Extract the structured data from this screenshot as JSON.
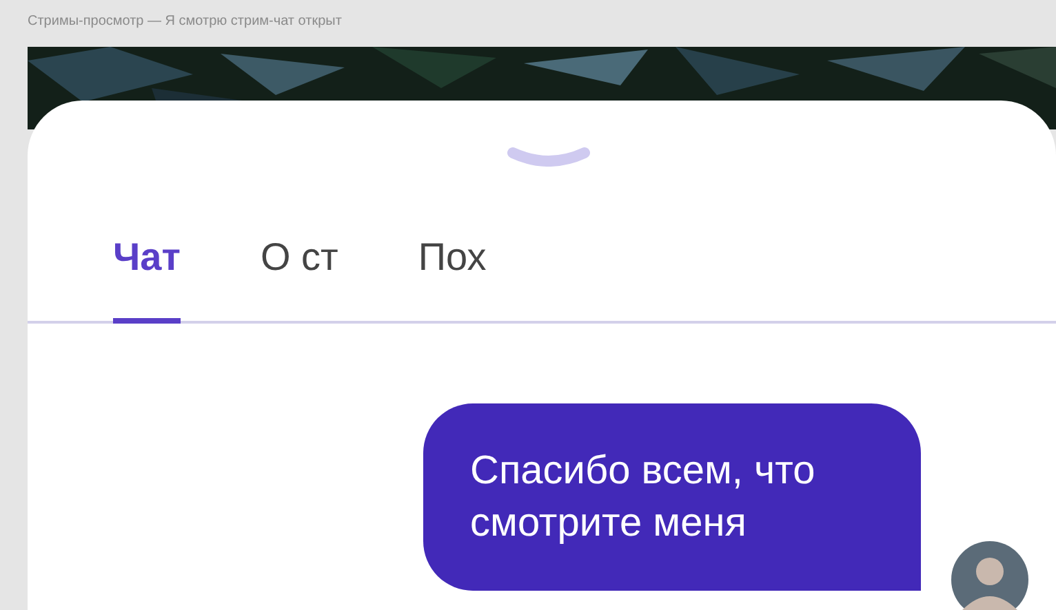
{
  "frame_label": "Стримы-просмотр — Я смотрю стрим-чат открыт",
  "tabs": [
    {
      "label": "Чат",
      "selected": true
    },
    {
      "label": "О ст",
      "selected": false
    },
    {
      "label": "Пох",
      "selected": false
    }
  ],
  "messages": [
    {
      "text": "Спасибо всем, что смотрите меня",
      "outgoing": true
    }
  ]
}
